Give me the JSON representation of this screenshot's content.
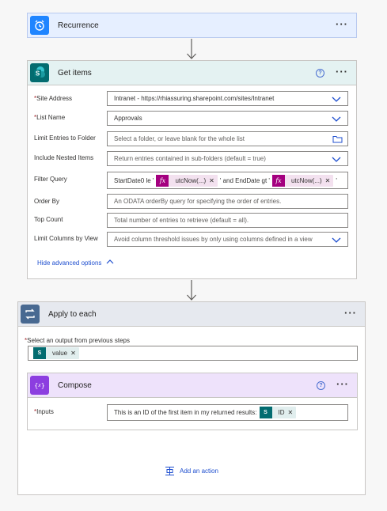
{
  "recurrence": {
    "title": "Recurrence",
    "menu": "···"
  },
  "get_items": {
    "title": "Get items",
    "help": "?",
    "menu": "···",
    "site_address": {
      "label": "Site Address",
      "value": "Intranet - https://rhiassuring.sharepoint.com/sites/Intranet"
    },
    "list_name": {
      "label": "List Name",
      "value": "Approvals"
    },
    "limit_folder": {
      "label": "Limit Entries to Folder",
      "placeholder": "Select a folder, or leave blank for the whole list"
    },
    "nested_items": {
      "label": "Include Nested Items",
      "placeholder": "Return entries contained in sub-folders (default = true)"
    },
    "filter_query": {
      "label": "Filter Query",
      "text1": "StartDate0 le '",
      "token1": "utcNow(...)",
      "text2": "' and EndDate gt '",
      "token2": "utcNow(...)",
      "text3": "'"
    },
    "order_by": {
      "label": "Order By",
      "placeholder": "An ODATA orderBy query for specifying the order of entries."
    },
    "top_count": {
      "label": "Top Count",
      "placeholder": "Total number of entries to retrieve (default = all)."
    },
    "limit_columns": {
      "label": "Limit Columns by View",
      "placeholder": "Avoid column threshold issues by only using columns defined in a view"
    },
    "hide_advanced": "Hide advanced options"
  },
  "apply_each": {
    "title": "Apply to each",
    "menu": "···",
    "select_label": "Select an output from previous steps",
    "token": "value"
  },
  "compose": {
    "title": "Compose",
    "help": "?",
    "menu": "···",
    "inputs_label": "Inputs",
    "inputs_text": "This is an ID of the first item in my returned results:",
    "token": "ID"
  },
  "add_action": "Add an action",
  "token_icons": {
    "fx": "fx",
    "sp": "S"
  },
  "colors": {
    "recurrence": "#1f85ff",
    "sharepoint": "#036c70",
    "loop": "#486991",
    "compose": "#8c3ee0",
    "expression": "#a4007f",
    "link": "#1f4fcf"
  }
}
